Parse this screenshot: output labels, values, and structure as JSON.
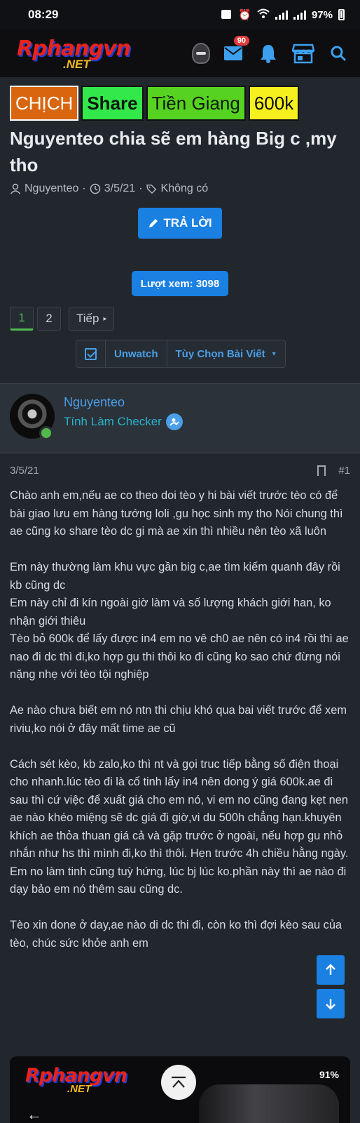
{
  "status_bar": {
    "time": "08:29",
    "battery": "97%"
  },
  "app_bar": {
    "logo_main": "Rphangvn",
    "logo_net": ".NET",
    "messages_badge": "90"
  },
  "thread": {
    "prefixes": [
      "CHỊCH",
      "Share",
      "Tiền Giang",
      "600k"
    ],
    "title": "Nguyenteo chia sẽ em hàng Big c ,my tho",
    "author": "Nguyenteo",
    "date": "3/5/21",
    "tags": "Không có",
    "reply_button": "TRẢ LỜI",
    "views": "Lượt xem: 3098"
  },
  "pagination": {
    "pages": [
      "1",
      "2"
    ],
    "next": "Tiếp"
  },
  "watch_bar": {
    "unwatch": "Unwatch",
    "options": "Tùy Chọn Bài Viết"
  },
  "post": {
    "user_name": "Nguyenteo",
    "user_title": "Tính Làm Checker",
    "date": "3/5/21",
    "number": "#1",
    "paragraphs": [
      "Chào anh em,nếu ae co theo doi tèo y hi bài viết trước tèo có để bài giao lưu em hàng tướng loli ,gu học sinh my tho Nói chung thì ae cũng ko share tèo dc gi mà ae xin thì nhiều nên tèo xã luôn",
      "Em này thường làm khu vực gần big c,ae tìm kiếm quanh đây rồi kb cũng dc\nEm này chỉ đi kín ngoài giờ làm và số lượng khách giới han, ko nhận giới thiêu\nTèo bỏ 600k để lấy được in4 em no vê ch0 ae nên có in4 rồi thì ae nao đi dc thì đi,ko hợp gu thi thôi ko đi cũng ko sao chứ đừng nói nặng nhẹ với tèo tội nghiệp",
      "Ae nào chưa biết em nó ntn thi chịu khó qua bai viết trước để xem riviu,ko nói ở đây mất time ae cũ",
      "Cách sét kèo, kb zalo,ko thì nt và gọi truc tiếp bằng số điện thoại cho nhanh.lúc tèo đi là cố tinh lấy in4 nên dong ý giá 600k.ae đi sau thì cứ việc để xuất giá cho em nó, vi em no cũng đang kẹt nen ae nào khéo miệng sẽ dc giá đi giờ,vi du 500h chẳng hạn.khuyên khích ae thỏa thuan giá cả và gặp trước ở ngoài, nếu hợp gu nhỏ nhắn như hs thì mình đi,ko thì thôi. Hẹn trước 4h chiều hằng ngày. Em no làm tinh cũng tuỳ hứng, lúc bj lúc ko.phần này thì ae nào đi dạy bảo em nó thêm sau cũng dc.",
      "Tèo xin done ở day,ae nào di dc thi đi, còn ko thì đợi kèo sau của tèo, chúc sức khỏe anh em"
    ]
  },
  "footer": {
    "logo_main": "Rphangvn",
    "logo_net": ".NET",
    "battery": "91%"
  },
  "colors": {
    "accent": "#1a80e2",
    "link": "#4a9fe8",
    "bg": "#22272e"
  }
}
